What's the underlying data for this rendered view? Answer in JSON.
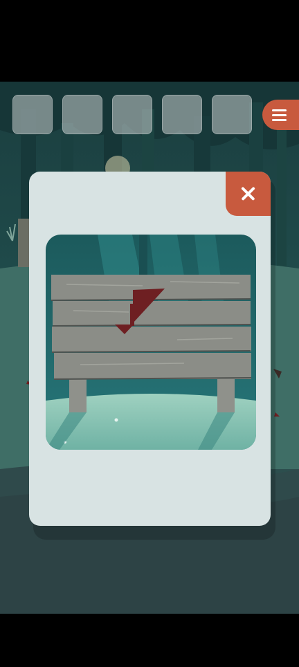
{
  "inventory": {
    "slots": [
      "empty",
      "empty",
      "empty",
      "empty",
      "empty"
    ]
  },
  "menu": {
    "icon": "hamburger-icon"
  },
  "modal": {
    "close_icon": "close-icon",
    "zoom_subject": "wooden-sign-with-red-arrow"
  },
  "colors": {
    "accent": "#c85a3e",
    "modal_bg": "#d8e3e3",
    "arrow": "#6e1f22",
    "wood": "#8a8c86"
  }
}
